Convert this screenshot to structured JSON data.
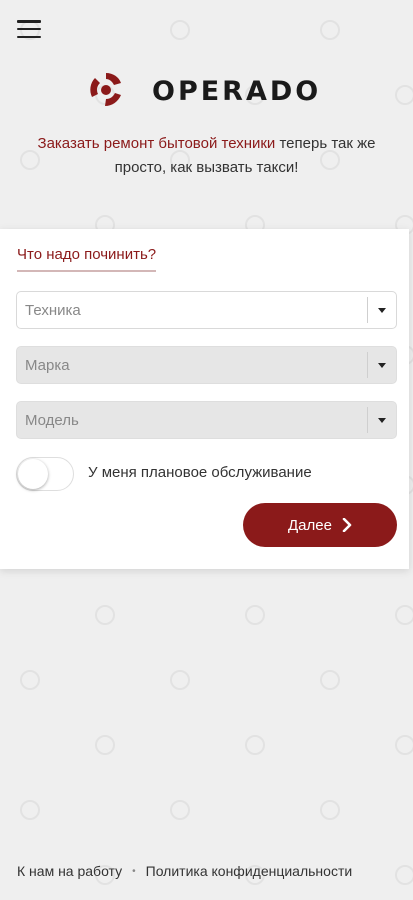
{
  "header": {
    "menu_icon": "hamburger-icon"
  },
  "brand": {
    "logo_text": "OPERADO",
    "logo_icon": "operado-logo-mark",
    "accent_color": "#8b1a1a"
  },
  "tagline": {
    "accent_part": "Заказать ремонт бытовой техники",
    "rest_part": " теперь так же просто, как вызвать такси!"
  },
  "form": {
    "title": "Что надо починить?",
    "selects": [
      {
        "placeholder": "Техника",
        "enabled": true
      },
      {
        "placeholder": "Марка",
        "enabled": false
      },
      {
        "placeholder": "Модель",
        "enabled": false
      }
    ],
    "maintenance_toggle": {
      "label": "У меня плановое обслуживание",
      "checked": false
    },
    "next_button": {
      "label": "Далее",
      "icon": "chevron-right-icon"
    }
  },
  "footer": {
    "links": [
      "К нам на работу",
      "Политика конфиденциальности"
    ],
    "separator": "•"
  }
}
